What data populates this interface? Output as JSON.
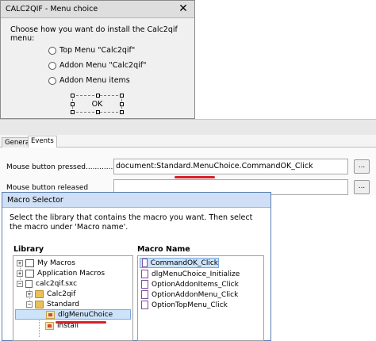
{
  "menu_dialog": {
    "title": "CALC2QIF - Menu choice",
    "close_glyph": "✕",
    "prompt": "Choose how  you want do install the Calc2qif menu:",
    "options": [
      {
        "label": "Top Menu \"Calc2qif\""
      },
      {
        "label": "Addon Menu \"Calc2qif\""
      },
      {
        "label": "Addon Menu items"
      }
    ],
    "ok_label": "OK"
  },
  "properties": {
    "tabs": [
      "General",
      "Events"
    ],
    "active_tab": "Events",
    "rows": [
      {
        "label": "Mouse button pressed......................",
        "value": "document:Standard.MenuChoice.CommandOK_Click",
        "button": "..."
      },
      {
        "label": "Mouse button released",
        "value": "",
        "button": "..."
      }
    ]
  },
  "macro_selector": {
    "title": "Macro Selector",
    "description": "Select the library that contains the macro you want. Then select the macro under 'Macro name'.",
    "library_header": "Library",
    "macro_header": "Macro Name",
    "library_tree": [
      {
        "label": "My Macros",
        "expander": "+",
        "icon": "macros-icon"
      },
      {
        "label": "Application Macros",
        "expander": "+",
        "icon": "macros-icon"
      },
      {
        "label": "calc2qif.sxc",
        "expander": "−",
        "icon": "document-icon"
      },
      {
        "label": "Calc2qif",
        "expander": "+",
        "icon": "library-folder-icon"
      },
      {
        "label": "Standard",
        "expander": "−",
        "icon": "library-folder-icon"
      },
      {
        "label": "dlgMenuChoice",
        "expander": "",
        "icon": "module-icon"
      },
      {
        "label": "install",
        "expander": "",
        "icon": "module-icon"
      }
    ],
    "selected_library": "dlgMenuChoice",
    "macros": [
      {
        "label": "CommandOK_Click"
      },
      {
        "label": "dlgMenuChoice_Initialize"
      },
      {
        "label": "OptionAddonItems_Click"
      },
      {
        "label": "OptionAddonMenu_Click"
      },
      {
        "label": "OptionTopMenu_Click"
      }
    ],
    "selected_macro": "CommandOK_Click"
  },
  "colors": {
    "highlight_red": "#d6202a",
    "selection_blue": "#cde3fa",
    "titlebar_blue": "#cfdff5"
  }
}
